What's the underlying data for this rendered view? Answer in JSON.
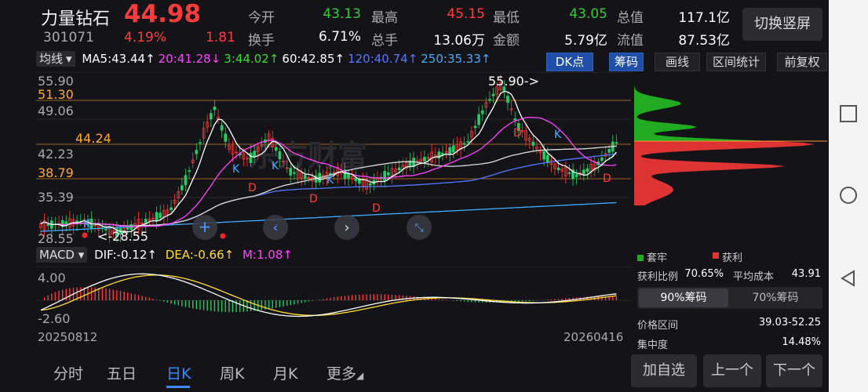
{
  "stock": {
    "name": "力量钻石",
    "price": "44.98",
    "code": "301071",
    "change_pct": "4.19%",
    "change": "1.81"
  },
  "quote": [
    {
      "label": "今开",
      "value": "43.13",
      "color": "#33cc33"
    },
    {
      "label": "最高",
      "value": "45.15",
      "color": "#ff3b3b"
    },
    {
      "label": "最低",
      "value": "43.05",
      "color": "#33cc33"
    },
    {
      "label": "总值",
      "value": "117.1亿",
      "color": "#ffffff"
    },
    {
      "label": "换手",
      "value": "6.71%",
      "color": "#ffffff"
    },
    {
      "label": "总手",
      "value": "13.06万",
      "color": "#ffffff"
    },
    {
      "label": "金额",
      "value": "5.79亿",
      "color": "#ffffff"
    },
    {
      "label": "流值",
      "value": "87.53亿",
      "color": "#ffffff"
    }
  ],
  "switch_button": "切换竖屏",
  "ma_selector": "均线",
  "ma": [
    {
      "text": "MA5:43.44↑",
      "color": "#ffffff"
    },
    {
      "text": "20:41.28↓",
      "color": "#ff44ff"
    },
    {
      "text": "3:44.02↑",
      "color": "#33dd33"
    },
    {
      "text": "60:42.85↑",
      "color": "#ffffff"
    },
    {
      "text": "120:40.74↑",
      "color": "#5577ff"
    },
    {
      "text": "250:35.33↑",
      "color": "#44aaff"
    }
  ],
  "tools": {
    "dk": "DK点",
    "chip": "筹码",
    "draw": "画线",
    "range": "区间统计",
    "adjust": "前复权"
  },
  "kline": {
    "yticks": [
      "55.90",
      "51.30",
      "49.06",
      "44.24",
      "42.23",
      "38.79",
      "35.39",
      "28.55"
    ],
    "high_label": "55.90->",
    "low_label": "<-28.55",
    "watermark": "东方财富",
    "signals": [
      "K",
      "K",
      "K",
      "K",
      "K",
      "D",
      "D",
      "D",
      "D",
      "D"
    ]
  },
  "macd": {
    "selector": "MACD",
    "dif": "DIF:-0.12↑",
    "dea": "DEA:-0.66↑",
    "m": "M:1.08↑",
    "top": "4.00",
    "bottom": "-2.60",
    "start_date": "20250812",
    "end_date": "20260416"
  },
  "tabs": [
    "分时",
    "五日",
    "日K",
    "周K",
    "月K",
    "更多"
  ],
  "active_tab": "日K",
  "chip_panel": {
    "legend_lock": "套牢",
    "legend_profit": "获利",
    "profit_ratio_label": "获利比例",
    "profit_ratio": "70.65%",
    "avg_cost_label": "平均成本",
    "avg_cost": "43.91",
    "tab90": "90%筹码",
    "tab70": "70%筹码",
    "price_range_label": "价格区间",
    "price_range": "39.03-52.25",
    "concentration_label": "集中度",
    "concentration": "14.48%"
  },
  "buttons": {
    "add": "加自选",
    "prev": "上一个",
    "next": "下一个"
  },
  "colors": {
    "up": "#ff3b3b",
    "down": "#33cc33",
    "accent": "#3d8bff"
  }
}
